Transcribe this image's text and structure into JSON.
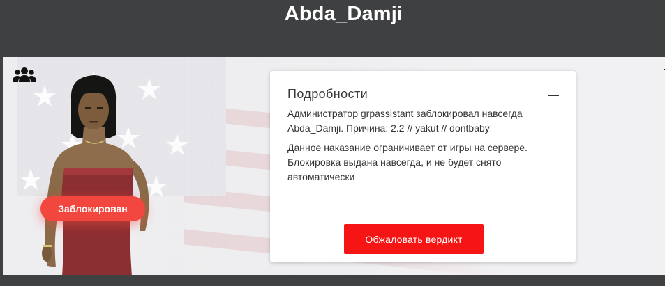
{
  "header": {
    "player_name": "Abda_Damji"
  },
  "profile": {
    "status_badge": "Заблокирован",
    "icons": {
      "group": "group-icon",
      "trash": "trash-icon"
    }
  },
  "details": {
    "title": "Подробности",
    "paragraphs": [
      "Администратор grpassistant заблокировал навсегда Abda_Damji. Причина: 2.2 // yakut // dontbaby",
      "Данное наказание ограничивает от игры на сервере. Блокировка выдана навсегда, и не будет снято автоматически"
    ],
    "appeal_button": "Обжаловать вердикт"
  },
  "colors": {
    "page_background": "#3f4041",
    "badge": "#f2473e",
    "appeal_button": "#f51515"
  }
}
